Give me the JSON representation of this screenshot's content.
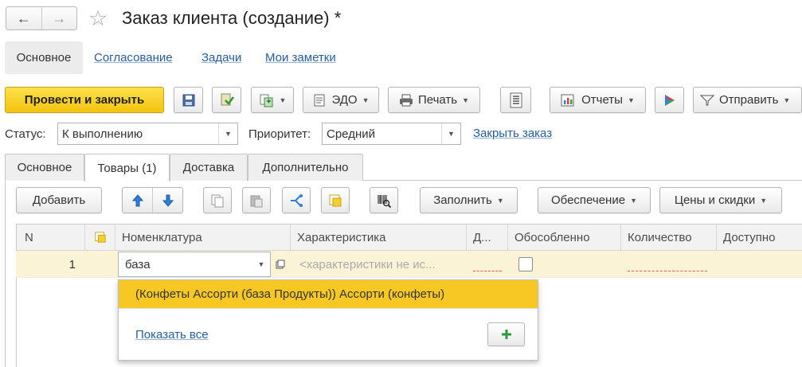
{
  "window": {
    "title": "Заказ клиента (создание) *"
  },
  "topnav": {
    "main": "Основное",
    "approval": "Согласование",
    "tasks": "Задачи",
    "notes": "Мои заметки"
  },
  "toolbar": {
    "post_close": "Провести и закрыть",
    "edo": "ЭДО",
    "print": "Печать",
    "reports": "Отчеты",
    "send": "Отправить"
  },
  "status": {
    "label": "Статус:",
    "value": "К выполнению",
    "priority_label": "Приоритет:",
    "priority_value": "Средний",
    "close_order": "Закрыть заказ"
  },
  "tabs": [
    "Основное",
    "Товары (1)",
    "Доставка",
    "Дополнительно"
  ],
  "goods_toolbar": {
    "add": "Добавить",
    "fill": "Заполнить",
    "provision": "Обеспечение",
    "prices": "Цены и скидки"
  },
  "table": {
    "headers": {
      "n": "N",
      "nomenclature": "Номенклатура",
      "characteristic": "Характеристика",
      "d": "Д...",
      "separate": "Обособленно",
      "quantity": "Количество",
      "available": "Доступно"
    },
    "row": {
      "n": "1",
      "nomenclature_input": "база",
      "characteristic_placeholder": "<характеристики не ис..."
    }
  },
  "popup": {
    "option": "(Конфеты Ассорти (база Продукты)) Ассорти (конфеты)",
    "show_all": "Показать все"
  },
  "colors": {
    "accent": "#f4c40e",
    "link": "#235ea6",
    "row_highlight": "#fbf3d5",
    "popup_selected": "#f7c823"
  }
}
